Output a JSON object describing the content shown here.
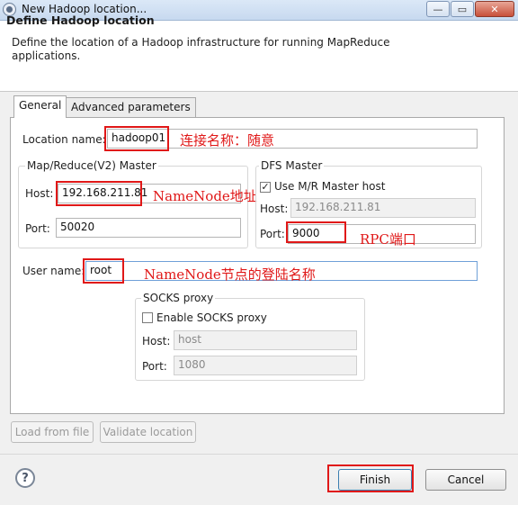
{
  "window": {
    "title": "New Hadoop location...",
    "minimize": "—",
    "maximize": "▭",
    "close": "✕"
  },
  "header": {
    "title": "Define Hadoop location",
    "description": "Define the location of a Hadoop infrastructure for running MapReduce applications."
  },
  "tabs": [
    {
      "label": "General",
      "active": true
    },
    {
      "label": "Advanced parameters",
      "active": false
    }
  ],
  "general": {
    "location_name": {
      "label": "Location name:",
      "value": "hadoop01",
      "annotation": "连接名称：随意"
    },
    "mapreduce_master": {
      "title": "Map/Reduce(V2) Master",
      "host_label": "Host:",
      "host_value": "192.168.211.81",
      "host_annotation": "NameNode地址",
      "port_label": "Port:",
      "port_value": "50020"
    },
    "dfs_master": {
      "title": "DFS Master",
      "use_mr_host_label": "Use M/R Master host",
      "use_mr_host_checked": true,
      "host_label": "Host:",
      "host_value": "192.168.211.81",
      "port_label": "Port:",
      "port_value": "9000",
      "port_annotation": "RPC端口"
    },
    "user_name": {
      "label": "User name:",
      "value": "root",
      "annotation": "NameNode节点的登陆名称"
    },
    "socks_proxy": {
      "title": "SOCKS proxy",
      "enable_label": "Enable SOCKS proxy",
      "enable_checked": false,
      "host_label": "Host:",
      "host_value": "host",
      "port_label": "Port:",
      "port_value": "1080"
    }
  },
  "buttons": {
    "load_from_file": "Load from file",
    "validate_location": "Validate location",
    "finish": "Finish",
    "cancel": "Cancel",
    "help": "?"
  },
  "colors": {
    "annotation": "#e01818",
    "titlebar": "#c7d9ef"
  }
}
